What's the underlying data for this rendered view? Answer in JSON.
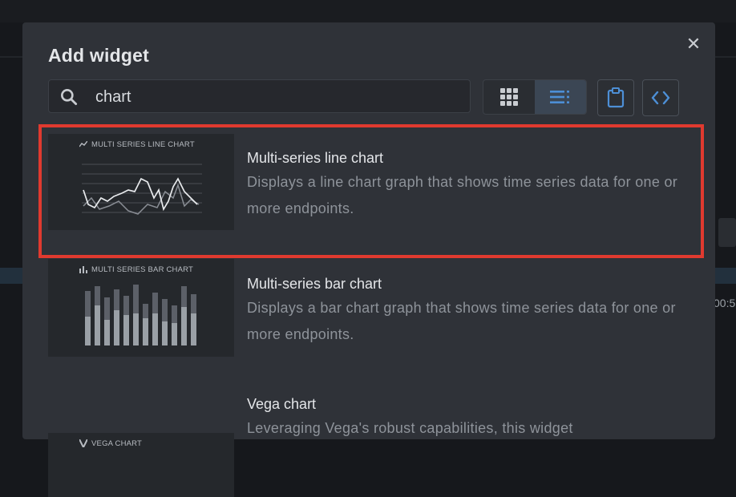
{
  "background": {
    "time_fragment": "00:5"
  },
  "dialog": {
    "title": "Add widget",
    "close_icon": "close-icon"
  },
  "search": {
    "value": "chart",
    "icon": "search-icon"
  },
  "toolbar": {
    "grid_view_icon": "grid-view-icon",
    "list_view_icon": "list-view-icon",
    "list_view_active": true,
    "clipboard_icon": "clipboard-icon",
    "code_icon": "code-icon"
  },
  "widgets": [
    {
      "thumbnail_label": "MULTI SERIES LINE CHART",
      "thumbnail_icon": "line-chart-icon",
      "title": "Multi-series line chart",
      "description": "Displays a line chart graph that shows time series data for one or more endpoints.",
      "highlighted": true
    },
    {
      "thumbnail_label": "MULTI SERIES BAR CHART",
      "thumbnail_icon": "bar-chart-icon",
      "title": "Multi-series bar chart",
      "description": "Displays a bar chart graph that shows time series data for one or more endpoints."
    },
    {
      "thumbnail_label": "VEGA CHART",
      "thumbnail_icon": "vega-icon",
      "title": "Vega chart",
      "description": "Leveraging Vega's robust capabilities, this widget"
    }
  ],
  "colors": {
    "highlight": "#e03a2f",
    "accent": "#4d8fd6",
    "modal_bg": "#2f3238"
  }
}
